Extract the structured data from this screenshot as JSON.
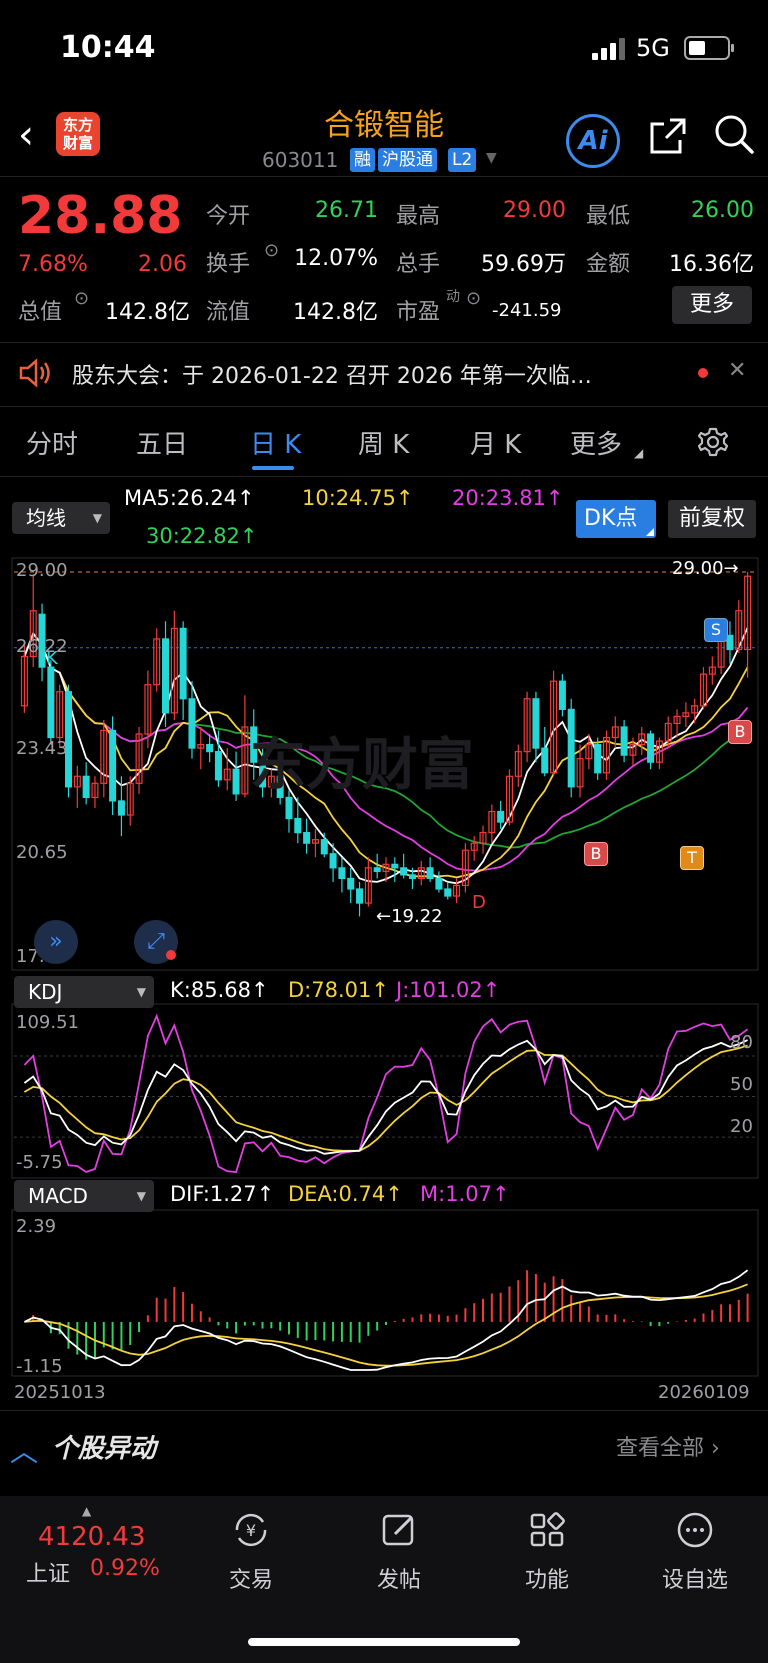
{
  "status_bar": {
    "time": "10:44",
    "network": "5G"
  },
  "header": {
    "logo_line1": "东方",
    "logo_line2": "财富",
    "stock_name": "合锻智能",
    "stock_code": "603011",
    "tags": [
      "融",
      "沪股通",
      "L2"
    ],
    "ai_label": "Ai"
  },
  "quote": {
    "price": "28.88",
    "change_pct": "7.68%",
    "change": "2.06",
    "open_label": "今开",
    "open": "26.71",
    "high_label": "最高",
    "high": "29.00",
    "low_label": "最低",
    "low": "26.00",
    "turnover_label": "换手",
    "turnover": "12.07%",
    "volume_label": "总手",
    "volume": "59.69万",
    "amount_label": "金额",
    "amount": "16.36亿",
    "total_mv_label": "总值",
    "total_mv": "142.8亿",
    "float_mv_label": "流值",
    "float_mv": "142.8亿",
    "pe_label": "市盈",
    "pe_sup": "动",
    "pe": "-241.59",
    "more_label": "更多"
  },
  "notice": {
    "text": "股东大会：于 2026-01-22 召开 2026 年第一次临…"
  },
  "tabs": [
    "分时",
    "五日",
    "日 K",
    "周 K",
    "月 K",
    "更多"
  ],
  "ma_row": {
    "selector": "均线",
    "ma5": "MA5:26.24",
    "ma10": "10:24.75",
    "ma20": "20:23.81",
    "ma30": "30:22.82",
    "dk_label": "DK点",
    "fq_label": "前复权"
  },
  "kline": {
    "y_labels": [
      "29.00",
      "26.22",
      "23.43",
      "20.65",
      "17.87"
    ],
    "high_marker": "29.00",
    "low_marker": "19.22",
    "watermark": "东方财富",
    "k_mark": "K",
    "d_mark": "D",
    "signals": [
      "S",
      "B",
      "B",
      "T"
    ]
  },
  "kdj": {
    "selector": "KDJ",
    "k": "K:85.68",
    "d": "D:78.01",
    "j": "J:101.02",
    "max": "109.51",
    "min": "-5.75",
    "levels": [
      "80",
      "50",
      "20"
    ]
  },
  "macd": {
    "selector": "MACD",
    "dif": "DIF:1.27",
    "dea": "DEA:0.74",
    "m": "M:1.07",
    "max": "2.39",
    "min": "-1.15",
    "date_start": "20251013",
    "date_end": "20260109"
  },
  "stock_move": {
    "title": "个股异动",
    "view_all": "查看全部"
  },
  "bottom_nav": {
    "index_value": "4120.43",
    "index_name": "上证",
    "index_pct": "0.92%",
    "items": [
      "交易",
      "发帖",
      "功能",
      "设自选"
    ]
  },
  "colors": {
    "up": "#f23a3a",
    "down": "#27d6d6",
    "ma5": "#ffffff",
    "ma10": "#f5d23c",
    "ma20": "#e33ee3",
    "ma30": "#22a632",
    "accent": "#3c8cf0",
    "brand": "#f7a318"
  },
  "chart_data": {
    "type": "candlestick",
    "x_range": [
      "20251013",
      "20260109"
    ],
    "ylim": [
      17.87,
      29.0
    ],
    "y_ticks": [
      29.0,
      26.22,
      23.43,
      20.65,
      17.87
    ],
    "candles": [
      [
        25.2,
        27.0,
        25.0,
        26.6
      ],
      [
        26.6,
        28.9,
        26.3,
        27.9
      ],
      [
        27.8,
        28.1,
        25.9,
        26.3
      ],
      [
        26.3,
        26.5,
        24.1,
        24.3
      ],
      [
        24.3,
        25.8,
        24.0,
        25.6
      ],
      [
        25.6,
        25.8,
        22.6,
        22.9
      ],
      [
        22.9,
        23.5,
        22.3,
        23.2
      ],
      [
        23.2,
        23.6,
        22.4,
        22.6
      ],
      [
        22.6,
        23.2,
        22.3,
        23.0
      ],
      [
        23.0,
        24.8,
        22.6,
        24.5
      ],
      [
        24.5,
        24.9,
        22.1,
        22.5
      ],
      [
        22.5,
        23.2,
        21.5,
        22.1
      ],
      [
        22.1,
        23.2,
        21.8,
        23.0
      ],
      [
        23.0,
        24.6,
        22.7,
        24.4
      ],
      [
        24.4,
        26.2,
        24.0,
        25.8
      ],
      [
        25.8,
        27.4,
        25.6,
        27.1
      ],
      [
        27.1,
        27.6,
        24.6,
        25.0
      ],
      [
        25.0,
        27.9,
        24.8,
        27.4
      ],
      [
        27.4,
        27.6,
        24.8,
        25.4
      ],
      [
        25.4,
        25.9,
        23.7,
        24.0
      ],
      [
        24.0,
        24.6,
        23.4,
        24.1
      ],
      [
        24.1,
        24.4,
        23.6,
        23.9
      ],
      [
        23.9,
        24.5,
        22.9,
        23.1
      ],
      [
        23.1,
        24.0,
        22.8,
        23.4
      ],
      [
        23.4,
        23.9,
        22.5,
        22.7
      ],
      [
        22.7,
        25.5,
        22.6,
        24.6
      ],
      [
        24.6,
        25.1,
        23.1,
        23.6
      ],
      [
        23.6,
        24.1,
        22.6,
        22.9
      ],
      [
        22.9,
        23.4,
        22.6,
        23.2
      ],
      [
        23.2,
        23.5,
        22.4,
        22.6
      ],
      [
        22.6,
        22.8,
        21.6,
        22.0
      ],
      [
        22.0,
        22.6,
        21.3,
        21.6
      ],
      [
        21.6,
        22.0,
        21.0,
        21.3
      ],
      [
        21.3,
        21.7,
        20.9,
        21.4
      ],
      [
        21.4,
        21.6,
        20.9,
        21.0
      ],
      [
        21.0,
        21.3,
        20.2,
        20.6
      ],
      [
        20.6,
        20.9,
        19.9,
        20.3
      ],
      [
        20.3,
        20.6,
        19.6,
        20.0
      ],
      [
        20.0,
        20.2,
        19.22,
        19.6
      ],
      [
        19.6,
        20.9,
        19.5,
        20.6
      ],
      [
        20.6,
        21.0,
        20.3,
        20.5
      ],
      [
        20.5,
        20.9,
        20.2,
        20.7
      ],
      [
        20.7,
        20.9,
        20.2,
        20.6
      ],
      [
        20.6,
        21.0,
        20.3,
        20.4
      ],
      [
        20.4,
        20.6,
        20.0,
        20.3
      ],
      [
        20.3,
        20.8,
        20.1,
        20.6
      ],
      [
        20.6,
        20.9,
        20.2,
        20.3
      ],
      [
        20.3,
        20.5,
        19.9,
        20.0
      ],
      [
        20.0,
        20.2,
        19.7,
        19.8
      ],
      [
        19.8,
        20.3,
        19.6,
        20.1
      ],
      [
        20.1,
        21.3,
        19.9,
        21.1
      ],
      [
        21.1,
        21.5,
        20.8,
        21.3
      ],
      [
        21.3,
        21.8,
        21.0,
        21.6
      ],
      [
        21.6,
        22.4,
        21.3,
        22.2
      ],
      [
        22.2,
        22.5,
        21.7,
        21.9
      ],
      [
        21.9,
        23.4,
        21.8,
        23.2
      ],
      [
        23.2,
        24.1,
        22.9,
        23.9
      ],
      [
        23.9,
        25.6,
        23.6,
        25.4
      ],
      [
        25.4,
        25.6,
        23.6,
        24.0
      ],
      [
        24.0,
        24.6,
        23.2,
        23.3
      ],
      [
        23.3,
        26.2,
        23.2,
        25.9
      ],
      [
        25.9,
        26.1,
        24.9,
        25.1
      ],
      [
        25.1,
        25.4,
        22.6,
        22.9
      ],
      [
        22.9,
        24.1,
        22.6,
        23.7
      ],
      [
        23.7,
        24.4,
        23.4,
        24.1
      ],
      [
        24.1,
        24.3,
        23.1,
        23.3
      ],
      [
        23.3,
        24.5,
        23.1,
        24.3
      ],
      [
        24.3,
        24.9,
        24.0,
        24.6
      ],
      [
        24.6,
        24.8,
        23.6,
        23.8
      ],
      [
        23.8,
        24.3,
        23.5,
        24.1
      ],
      [
        24.1,
        24.6,
        23.8,
        24.4
      ],
      [
        24.4,
        24.5,
        23.4,
        23.6
      ],
      [
        23.6,
        24.3,
        23.4,
        24.2
      ],
      [
        24.2,
        24.9,
        24.0,
        24.7
      ],
      [
        24.7,
        25.1,
        24.3,
        24.9
      ],
      [
        24.9,
        25.3,
        24.6,
        25.0
      ],
      [
        25.0,
        25.4,
        24.7,
        25.2
      ],
      [
        25.2,
        26.3,
        25.1,
        26.1
      ],
      [
        26.1,
        26.6,
        25.8,
        26.3
      ],
      [
        26.3,
        27.4,
        26.1,
        27.2
      ],
      [
        27.2,
        27.6,
        26.4,
        26.8
      ],
      [
        26.8,
        28.2,
        26.7,
        27.9
      ],
      [
        26.8,
        29.0,
        26.0,
        28.88
      ]
    ]
  }
}
